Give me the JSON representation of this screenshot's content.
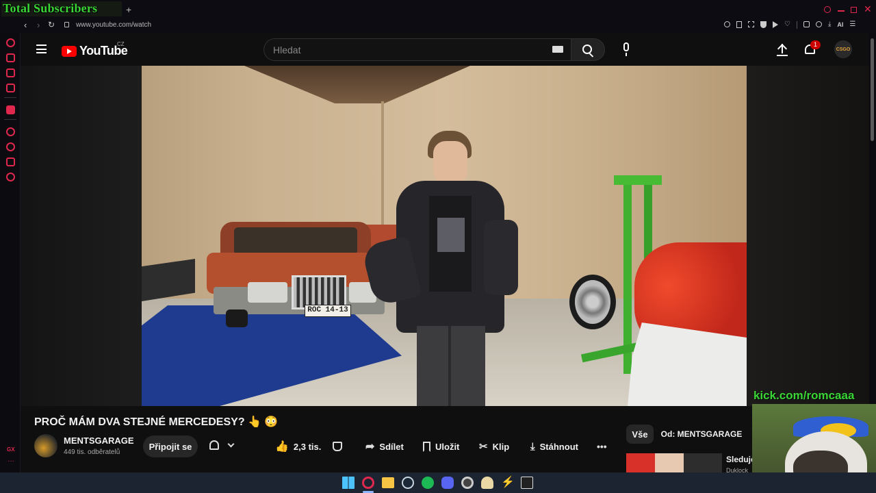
{
  "overlay": {
    "title_text": "Total Subscribers",
    "kick_text": "kick.com/romcaaa"
  },
  "browser": {
    "url": "www.youtube.com/watch",
    "accent": "#e0284f",
    "gx_label": "GX",
    "ai_label": "AI"
  },
  "youtube": {
    "logo_text": "YouTube",
    "region": "CZ",
    "search_placeholder": "Hledat",
    "notifications_count": "1",
    "avatar_text": "CSGO"
  },
  "video": {
    "title": "PROČ MÁM DVA STEJNÉ MERCEDESY? 👆 😳",
    "plate_text": "ROC 14-13",
    "channel_name": "MENTSGARAGE",
    "subscribers": "449 tis. odběratelů",
    "join_label": "Připojit se",
    "like_count": "2,3 tis.",
    "share_label": "Sdílet",
    "save_label": "Uložit",
    "clip_label": "Klip",
    "download_label": "Stáhnout"
  },
  "side": {
    "filter_all": "Vše",
    "filter_from": "Od: MENTSGARAGE",
    "next_title": "Sleduje",
    "next_sub": "Duklock"
  },
  "taskbar_icons": [
    "windows-icon",
    "opera-gx-icon",
    "folder-icon",
    "steam-icon",
    "spotify-icon",
    "discord-icon",
    "chrome-icon",
    "pen-icon",
    "lightning-icon",
    "epic-icon"
  ]
}
